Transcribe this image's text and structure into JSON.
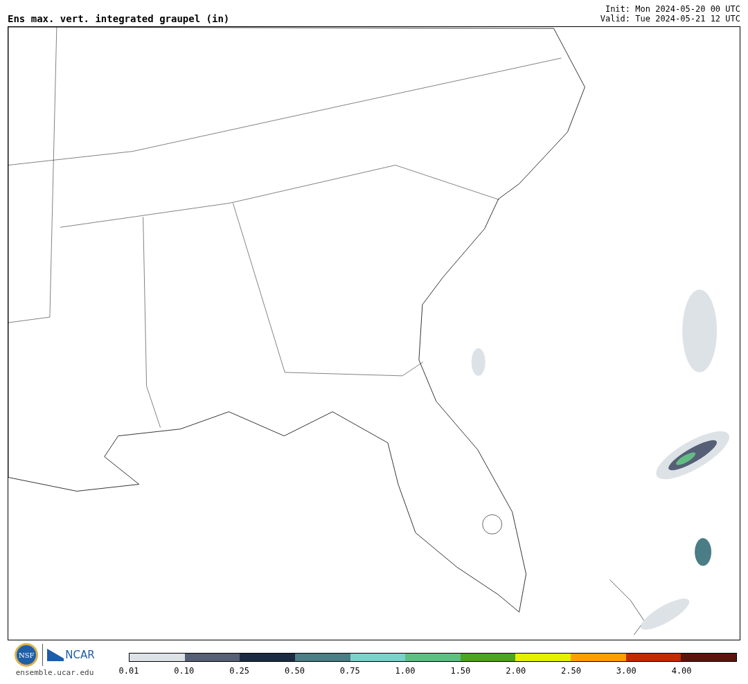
{
  "header": {
    "title": "Ens max. vert. integrated graupel (in)",
    "init": "Init: Mon 2024-05-20 00 UTC",
    "valid": "Valid: Tue 2024-05-21 12 UTC"
  },
  "footer": {
    "logo_nsf": "NSF",
    "logo_ncar": "NCAR",
    "url": "ensemble.ucar.edu"
  },
  "legend": {
    "bins": [
      {
        "label": "0.01",
        "color": "#dde2e7"
      },
      {
        "label": "0.10",
        "color": "#555f75"
      },
      {
        "label": "0.25",
        "color": "#1b2b43"
      },
      {
        "label": "0.50",
        "color": "#4a7d85"
      },
      {
        "label": "0.75",
        "color": "#80cfcb"
      },
      {
        "label": "1.00",
        "color": "#63bd82"
      },
      {
        "label": "1.50",
        "color": "#4ea325"
      },
      {
        "label": "2.00",
        "color": "#e4f000"
      },
      {
        "label": "2.50",
        "color": "#ff9e00"
      },
      {
        "label": "3.00",
        "color": "#c42900"
      },
      {
        "label": "4.00",
        "color": "#5a150c"
      }
    ]
  }
}
